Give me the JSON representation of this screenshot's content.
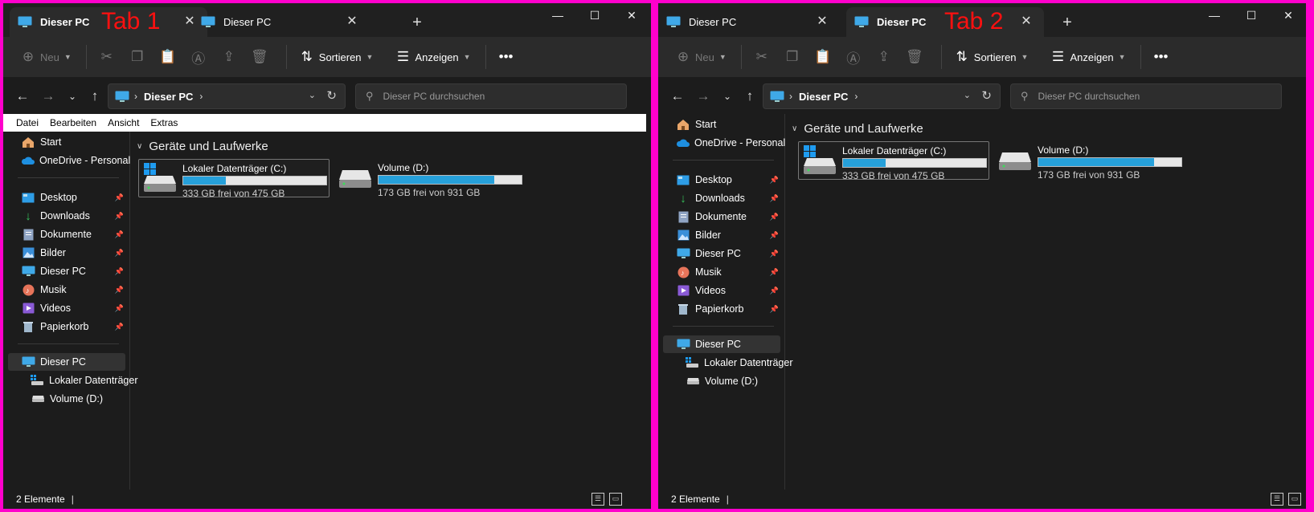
{
  "annotations": {
    "tab1": "Tab 1",
    "tab2": "Tab 2"
  },
  "tabs": {
    "label": "Dieser PC",
    "close": "✕",
    "new": "+"
  },
  "window_controls": {
    "min": "—",
    "max": "☐",
    "close": "✕"
  },
  "toolbar": {
    "new": "Neu",
    "sort": "Sortieren",
    "view": "Anzeigen",
    "more": "•••"
  },
  "address": {
    "crumb": "Dieser PC",
    "sep": "›",
    "search_placeholder": "Dieser PC durchsuchen"
  },
  "menubar": {
    "items": [
      "Datei",
      "Bearbeiten",
      "Ansicht",
      "Extras"
    ]
  },
  "sidebar": {
    "top": [
      {
        "label": "Start",
        "icon": "home-icon"
      },
      {
        "label": "OneDrive - Personal",
        "icon": "onedrive-icon"
      }
    ],
    "pinned": [
      {
        "label": "Desktop",
        "icon": "desktop-icon"
      },
      {
        "label": "Downloads",
        "icon": "downloads-icon"
      },
      {
        "label": "Dokumente",
        "icon": "documents-icon"
      },
      {
        "label": "Bilder",
        "icon": "pictures-icon"
      },
      {
        "label": "Dieser PC",
        "icon": "pc-icon"
      },
      {
        "label": "Musik",
        "icon": "music-icon"
      },
      {
        "label": "Videos",
        "icon": "videos-icon"
      },
      {
        "label": "Papierkorb",
        "icon": "recycle-bin-icon"
      }
    ],
    "tree": [
      {
        "label": "Dieser PC",
        "icon": "pc-icon"
      },
      {
        "label": "Lokaler Datenträger",
        "icon": "drive-c-icon"
      },
      {
        "label": "Volume (D:)",
        "icon": "drive-icon"
      }
    ]
  },
  "main": {
    "group": "Geräte und Laufwerke",
    "drives": [
      {
        "name": "Lokaler Datenträger (C:)",
        "free": "333 GB frei von 475 GB",
        "used_fraction": 0.3
      },
      {
        "name": "Volume (D:)",
        "free": "173 GB frei von 931 GB",
        "used_fraction": 0.81
      }
    ]
  },
  "status": {
    "count": "2 Elemente",
    "cursor": "|"
  },
  "colors": {
    "accent": "#26a0da",
    "frame": "#ff00cc",
    "annotation": "#ff1010"
  }
}
